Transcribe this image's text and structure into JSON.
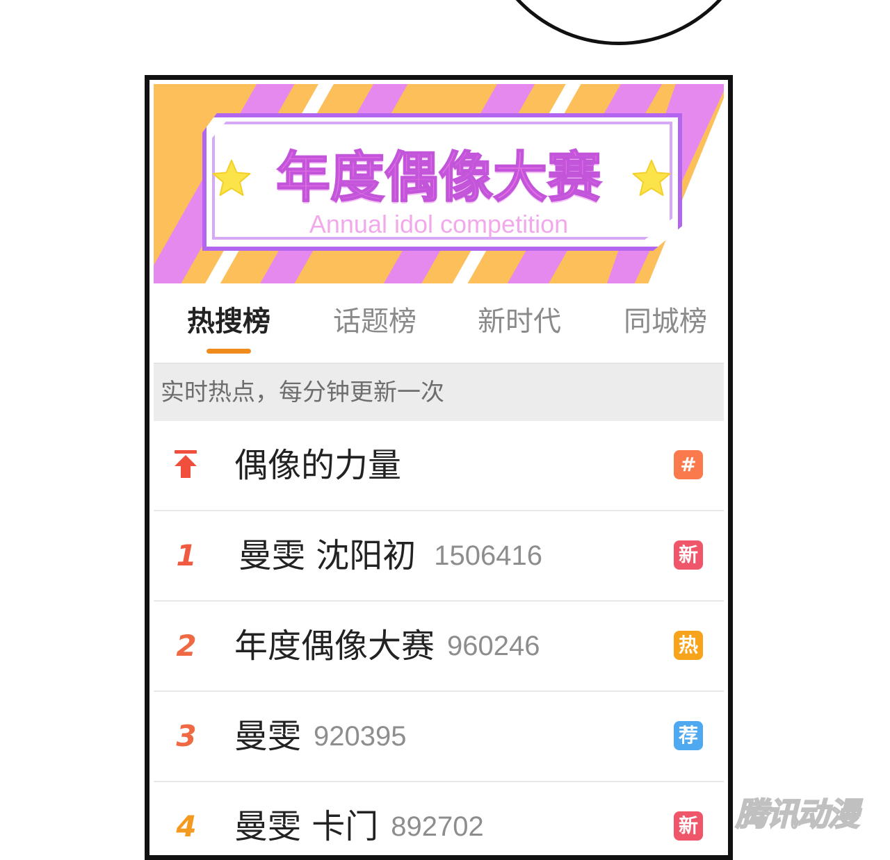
{
  "banner": {
    "title": "年度偶像大赛",
    "subtitle": "Annual idol competition"
  },
  "tabs": [
    {
      "label": "热搜榜",
      "active": true
    },
    {
      "label": "话题榜",
      "active": false
    },
    {
      "label": "新时代",
      "active": false
    },
    {
      "label": "同城榜",
      "active": false
    }
  ],
  "info_bar": {
    "text": "实时热点，每分钟更新一次"
  },
  "rows": [
    {
      "rank": "",
      "rank_icon": "pin-top-icon",
      "title": "偶像的力量",
      "count": "",
      "badge": "#",
      "badge_type": "topic",
      "badge_color": "#fa7a4e"
    },
    {
      "rank": "1",
      "title": "曼雯 沈阳初",
      "count": "1506416",
      "badge": "新",
      "badge_type": "new",
      "badge_color": "#f0566a",
      "rank_color": "#ef5a41"
    },
    {
      "rank": "2",
      "title": "年度偶像大赛",
      "count": "960246",
      "badge": "热",
      "badge_type": "hot",
      "badge_color": "#f7a41c",
      "rank_color": "#ef6a44"
    },
    {
      "rank": "3",
      "title": "曼雯",
      "count": "920395",
      "badge": "荐",
      "badge_type": "recommend",
      "badge_color": "#4ea9f0",
      "rank_color": "#ef6a44"
    },
    {
      "rank": "4",
      "title": "曼雯 卡门",
      "count": "892702",
      "badge": "新",
      "badge_type": "new",
      "badge_color": "#f0566a",
      "rank_color": "#f39a1f"
    }
  ],
  "watermark": "腾讯动漫",
  "colors": {
    "stripe_orange": "#fdbf5a",
    "stripe_purple": "#e589ef",
    "frame_purple": "#b265ee",
    "title_pink": "#e56fe6",
    "tab_indicator": "#f08a1c"
  }
}
